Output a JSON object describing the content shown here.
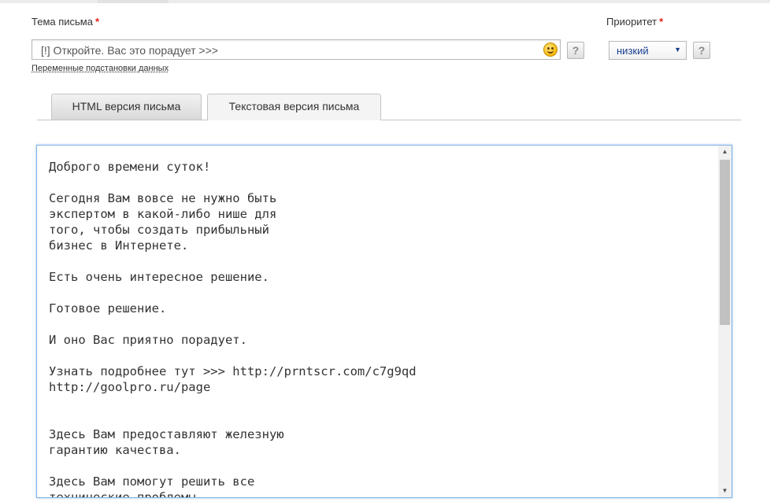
{
  "subject": {
    "label": "Тема письма",
    "required_mark": "*",
    "value": "[!] Откройте. Вас это порадует >>>",
    "emoji_icon": "smiley-icon",
    "help": "?",
    "variables_link": "Переменные подстановки данных"
  },
  "priority": {
    "label": "Приоритет",
    "required_mark": "*",
    "selected": "низкий",
    "help": "?"
  },
  "tabs": [
    {
      "label": "HTML версия письма",
      "active": false
    },
    {
      "label": "Текстовая версия письма",
      "active": true
    }
  ],
  "editor": {
    "text": "Доброго времени суток!\n\nСегодня Вам вовсе не нужно быть\nэкспертом в какой-либо нише для\nтого, чтобы создать прибыльный\nбизнес в Интернете.\n\nЕсть очень интересное решение.\n\nГотовое решение.\n\nИ оно Вас приятно порадует.\n\nУзнать подробнее тут >>> http://prntscr.com/c7g9qd\nhttp://goolpro.ru/page\n\n\nЗдесь Вам предоставляют железную\nгарантию качества.\n\nЗдесь Вам помогут решить все\nтехнические проблемы"
  },
  "colors": {
    "required": "#e2231a",
    "select_text": "#1a3f8f",
    "editor_focus_border": "#7fb2e5"
  }
}
